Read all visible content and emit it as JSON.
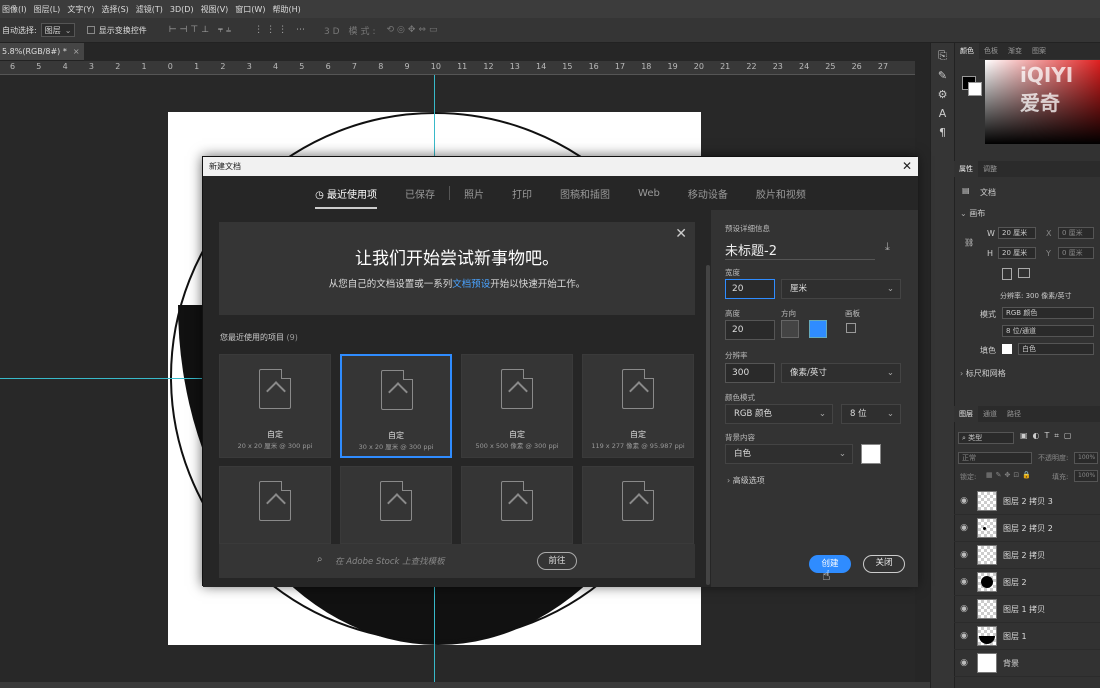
{
  "menubar": [
    "图像(I)",
    "图层(L)",
    "文字(Y)",
    "选择(S)",
    "滤镜(T)",
    "3D(D)",
    "视图(V)",
    "窗口(W)",
    "帮助(H)"
  ],
  "options": {
    "auto_select_label": "自动选择:",
    "auto_select_value": "图层",
    "show_transform_label": "显示变换控件",
    "mode_3d": "3D 模式:"
  },
  "doc_tab": "5.8%(RGB/8#) *",
  "ruler_ticks": [
    "6",
    "5",
    "4",
    "3",
    "2",
    "1",
    "0",
    "1",
    "2",
    "3",
    "4",
    "5",
    "6",
    "7",
    "8",
    "9",
    "10",
    "11",
    "12",
    "13",
    "14",
    "15",
    "16",
    "17",
    "18",
    "19",
    "20",
    "21",
    "22",
    "23",
    "24",
    "25",
    "26",
    "27"
  ],
  "dialog": {
    "title": "新建文档",
    "tabs": [
      "最近使用项",
      "已保存",
      "照片",
      "打印",
      "图稿和插图",
      "Web",
      "移动设备",
      "胶片和视频"
    ],
    "welcome_title": "让我们开始尝试新事物吧。",
    "welcome_sub_pre": "从您自己的文档设置或一系列",
    "welcome_sub_link": "文档预设",
    "welcome_sub_post": "开始以快速开始工作。",
    "recent_label": "您最近使用的项目",
    "recent_count": "(9)",
    "cards": [
      {
        "name": "自定",
        "desc": "20 x 20 厘米 @ 300 ppi"
      },
      {
        "name": "自定",
        "desc": "30 x 20 厘米 @ 300 ppi"
      },
      {
        "name": "自定",
        "desc": "500 x 500 像素 @ 300 ppi"
      },
      {
        "name": "自定",
        "desc": "119 x 277 像素 @ 95.987 ppi"
      }
    ],
    "stock_placeholder": "在 Adobe Stock 上查找模板",
    "go_button": "前往",
    "preset_label": "预设详细信息",
    "doc_name": "未标题-2",
    "width_label": "宽度",
    "width_value": "20",
    "width_unit": "厘米",
    "height_label": "高度",
    "height_value": "20",
    "orientation_label": "方向",
    "artboard_label": "画板",
    "resolution_label": "分辨率",
    "resolution_value": "300",
    "resolution_unit": "像素/英寸",
    "color_mode_label": "颜色模式",
    "color_mode": "RGB 颜色",
    "bit_depth": "8 位",
    "bg_label": "背景内容",
    "bg_value": "白色",
    "advanced": "高级选项",
    "create": "创建",
    "close": "关闭"
  },
  "panel": {
    "color_tabs": [
      "颜色",
      "色板",
      "渐变",
      "图案"
    ],
    "prop_tabs": [
      "属性",
      "调整"
    ],
    "doc_label": "文档",
    "canvas_label": "画布",
    "w_label": "W",
    "w_value": "20 厘米",
    "h_label": "H",
    "h_value": "20 厘米",
    "x_label": "X",
    "x_value": "0 厘米",
    "y_label": "Y",
    "y_value": "0 厘米",
    "resolution_text": "分辨率: 300 像素/英寸",
    "mode_label": "模式",
    "mode_value": "RGB 颜色",
    "bits_value": "8 位/通道",
    "fill_label": "填色",
    "fill_value": "白色",
    "rulers_label": "标尺和网格",
    "layer_tabs": [
      "图层",
      "通道",
      "路径"
    ],
    "kind_label": "类型",
    "blend_mode": "正常",
    "opacity_label": "不透明度:",
    "opacity_value": "100%",
    "lock_label": "锁定:",
    "fill_pct_label": "填充:",
    "fill_pct_value": "100%",
    "layers": [
      "图层 2 拷贝 3",
      "图层 2 拷贝 2",
      "图层 2 拷贝",
      "图层 2",
      "图层 1 拷贝",
      "图层 1",
      "背景"
    ]
  },
  "watermark": "iQIYI 爱奇"
}
